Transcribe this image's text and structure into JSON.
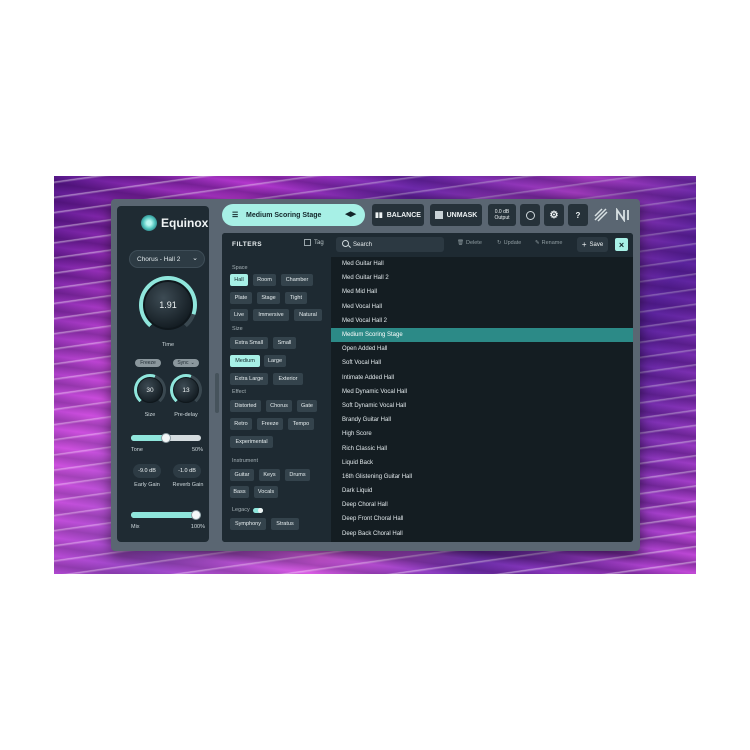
{
  "app": {
    "name": "Equinox",
    "preset_select": "Chorus - Hall 2"
  },
  "left_panel": {
    "time_value": "1.91",
    "time_label": "Time",
    "freeze_label": "Freeze",
    "sync_label": "Sync",
    "size_value": "30",
    "size_label": "Size",
    "predelay_value": "13",
    "predelay_label": "Pre-delay",
    "tone_label": "Tone",
    "tone_value": "50%",
    "tone_level": 0.5,
    "early_gain_value": "-9.0 dB",
    "early_gain_label": "Early Gain",
    "reverb_gain_value": "-1.0 dB",
    "reverb_gain_label": "Reverb Gain",
    "mix_label": "Mix",
    "mix_value": "100%",
    "mix_level": 1.0
  },
  "topbar": {
    "current_preset": "Medium Scoring Stage",
    "balance_label": "BALANCE",
    "unmask_label": "UNMASK",
    "output_value": "0.0 dB",
    "output_label": "Output",
    "help_label": "?"
  },
  "browser": {
    "filters_title": "FILTERS",
    "tag_label": "Tag",
    "search_placeholder": "Search",
    "delete_label": "Delete",
    "update_label": "Update",
    "rename_label": "Rename",
    "save_label": "Save",
    "sections": {
      "space": "Space",
      "size": "Size",
      "effect": "Effect",
      "instrument": "Instrument",
      "legacy": "Legacy"
    },
    "chips": {
      "hall": "Hall",
      "room": "Room",
      "chamber": "Chamber",
      "plate": "Plate",
      "stage": "Stage",
      "tight": "Tight",
      "live": "Live",
      "immersive": "Immersive",
      "natural": "Natural",
      "extra_small": "Extra Small",
      "small": "Small",
      "medium": "Medium",
      "large": "Large",
      "extra_large": "Extra Large",
      "exterior": "Exterior",
      "distorted": "Distorted",
      "chorus": "Chorus",
      "gate": "Gate",
      "retro": "Retro",
      "freeze": "Freeze",
      "tempo": "Tempo",
      "experimental": "Experimental",
      "guitar": "Guitar",
      "keys": "Keys",
      "drums": "Drums",
      "bass": "Bass",
      "vocals": "Vocals",
      "symphony": "Symphony",
      "stratus": "Stratus"
    },
    "presets": [
      "Med Guitar Hall",
      "Med Guitar Hall 2",
      "Med Mid Hall",
      "Med Vocal Hall",
      "Med Vocal Hall 2",
      "Medium Scoring Stage",
      "Open Added Hall",
      "Soft Vocal Hall",
      "Intimate Added Hall",
      "Med Dynamic Vocal Hall",
      "Soft Dynamic Vocal Hall",
      "Brandy Guitar Hall",
      "High Score",
      "Rich Classic Hall",
      "Liquid Back",
      "16th Glistening Guitar Hall",
      "Dark Liquid",
      "Deep Choral Hall",
      "Deep Front Choral Hall",
      "Deep Back Choral Hall"
    ],
    "selected_index": 5
  },
  "colors": {
    "accent": "#a7f0e6",
    "selection": "#2c8a87",
    "panel": "#1e2a32"
  }
}
